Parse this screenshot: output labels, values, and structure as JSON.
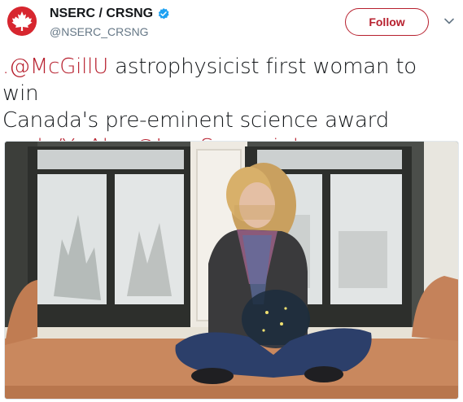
{
  "account": {
    "name": "NSERC / CRSNG",
    "handle": "@NSERC_CRSNG",
    "verified_icon": "verified-badge-icon",
    "avatar_icon": "maple-leaf-icon"
  },
  "follow_button": {
    "label": "Follow"
  },
  "tweet": {
    "line1_link": ".@McGillU",
    "line1_text": " astrophysicist first woman to win",
    "line2_text": "Canada's pre-eminent science award",
    "link_url": "ow.ly/YnAhg",
    "link_mention": "@IvanSemeniuk"
  },
  "colors": {
    "brand_red": "#b7202e",
    "verified_blue": "#1da1f2",
    "muted": "#657786"
  },
  "media": {
    "description_icon": "photo"
  }
}
